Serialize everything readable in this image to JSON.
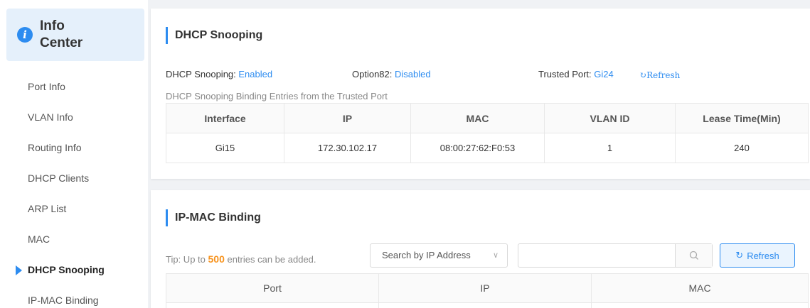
{
  "sidebar": {
    "header_title_line1": "Info",
    "header_title_line2": "Center",
    "items": [
      {
        "label": "Port Info"
      },
      {
        "label": "VLAN Info"
      },
      {
        "label": "Routing Info"
      },
      {
        "label": "DHCP Clients"
      },
      {
        "label": "ARP List"
      },
      {
        "label": "MAC"
      },
      {
        "label": "DHCP Snooping",
        "active": true
      },
      {
        "label": "IP-MAC Binding"
      }
    ]
  },
  "dhcp_snooping": {
    "title": "DHCP Snooping",
    "status_label": "DHCP Snooping: ",
    "status_value": "Enabled",
    "option82_label": "Option82: ",
    "option82_value": "Disabled",
    "trusted_label": "Trusted Port: ",
    "trusted_value": "Gi24",
    "refresh_label": "Refresh",
    "table_caption": "DHCP Snooping Binding Entries from the Trusted Port",
    "columns": [
      "Interface",
      "IP",
      "MAC",
      "VLAN ID",
      "Lease Time(Min)"
    ],
    "rows": [
      [
        "Gi15",
        "172.30.102.17",
        "08:00:27:62:F0:53",
        "1",
        "240"
      ]
    ]
  },
  "ip_mac_binding": {
    "title": "IP-MAC Binding",
    "tip_prefix": "Tip: Up to",
    "tip_count": "500",
    "tip_suffix": "entries can be added.",
    "search_select": "Search by IP Address",
    "search_placeholder": "",
    "refresh_label": "Refresh",
    "columns": [
      "Port",
      "IP",
      "MAC"
    ]
  },
  "colors": {
    "accent": "#2d8cf0",
    "warning": "#f7931e"
  }
}
